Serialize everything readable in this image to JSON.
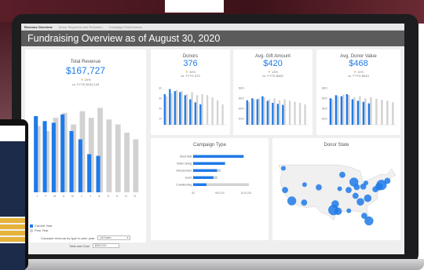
{
  "tabs": [
    "Revenue Overview",
    "Donor Segments and Retention",
    "Campaign Performance"
  ],
  "page_title": "Fundraising Overview as of August 30, 2020",
  "kpis": {
    "revenue": {
      "title": "Total Revenue",
      "value": "$167,727",
      "delta": "29%",
      "vs": "vs. FYTD $234,193"
    },
    "donors": {
      "title": "Donors",
      "value": "376",
      "delta": "34%",
      "vs": "vs. FYTD 570"
    },
    "gift": {
      "title": "Avg. Gift Amount",
      "value": "$420",
      "delta": "13%",
      "vs": "vs. FYTD $482"
    },
    "donor_value": {
      "title": "Avg. Donor Value",
      "value": "$468",
      "delta": "11%",
      "vs": "vs. FYTD $544"
    }
  },
  "legend": {
    "current": "Current Year",
    "prior": "Prior Year"
  },
  "controls": {
    "compare_label": "Compare revenue by type to prior year",
    "compare_value": "All Dates",
    "goal_label": "Total and Goal",
    "goal_value": "$500,000"
  },
  "campaign": {
    "title": "Campaign Type",
    "axis_ticks": [
      "$0",
      "$50,000",
      "$100,000"
    ]
  },
  "state": {
    "title": "Donor State"
  },
  "colors": {
    "current": "#1f7ae8",
    "prior": "#d2d2d2",
    "accent_arrow": "#e0a81c",
    "title_bar": "#5b5b5b"
  },
  "chart_data": [
    {
      "type": "bar",
      "title": "Total Revenue",
      "categories": [
        "J",
        "F",
        "M",
        "A",
        "M",
        "J",
        "J",
        "A",
        "S",
        "O",
        "N",
        "D"
      ],
      "series": [
        {
          "name": "Current Year",
          "values": [
            92,
            86,
            84,
            94,
            74,
            64,
            46,
            44,
            0,
            0,
            0,
            0
          ]
        },
        {
          "name": "Prior Year",
          "values": [
            80,
            74,
            90,
            96,
            82,
            98,
            90,
            102,
            88,
            82,
            72,
            64
          ]
        }
      ],
      "ylim": [
        0,
        110
      ]
    },
    {
      "type": "bar",
      "title": "Donors",
      "categories": [
        "1",
        "2",
        "3",
        "4",
        "5",
        "6",
        "7",
        "8",
        "9",
        "10",
        "11",
        "12"
      ],
      "series": [
        {
          "name": "Current Year",
          "values": [
            60,
            70,
            66,
            64,
            58,
            50,
            44,
            40,
            0,
            0,
            0,
            0
          ]
        },
        {
          "name": "Prior Year",
          "values": [
            56,
            62,
            68,
            66,
            60,
            64,
            58,
            60,
            58,
            54,
            48,
            40
          ]
        }
      ],
      "yticks": [
        "80",
        "60",
        "40",
        "20"
      ],
      "ylim": [
        0,
        80
      ]
    },
    {
      "type": "bar",
      "title": "Avg. Gift Amount",
      "categories": [
        "1",
        "2",
        "3",
        "4",
        "5",
        "6",
        "7",
        "8",
        "9",
        "10",
        "11",
        "12"
      ],
      "series": [
        {
          "name": "Current Year",
          "values": [
            480,
            520,
            500,
            560,
            470,
            430,
            410,
            390,
            0,
            0,
            0,
            0
          ]
        },
        {
          "name": "Prior Year",
          "values": [
            450,
            500,
            520,
            540,
            500,
            520,
            480,
            500,
            470,
            450,
            430,
            400
          ]
        }
      ],
      "yticks": [
        "$800",
        "$600",
        "$400",
        "$200"
      ],
      "ylim": [
        0,
        800
      ]
    },
    {
      "type": "bar",
      "title": "Avg. Donor Value",
      "categories": [
        "1",
        "2",
        "3",
        "4",
        "5",
        "6",
        "7",
        "8",
        "9",
        "10",
        "11",
        "12"
      ],
      "series": [
        {
          "name": "Current Year",
          "values": [
            520,
            580,
            560,
            600,
            500,
            470,
            450,
            420,
            0,
            0,
            0,
            0
          ]
        },
        {
          "name": "Prior Year",
          "values": [
            500,
            560,
            590,
            580,
            540,
            560,
            520,
            540,
            510,
            490,
            470,
            440
          ]
        }
      ],
      "yticks": [
        "$800",
        "$600",
        "$400",
        "$200"
      ],
      "ylim": [
        0,
        800
      ]
    },
    {
      "type": "bar",
      "title": "Campaign Type",
      "categories": [
        "Direct Mail",
        "Online Giving",
        "Advancement",
        "Event",
        "Crowdfunding"
      ],
      "series": [
        {
          "name": "Current Year",
          "values": [
            95000,
            60000,
            45000,
            38000,
            25000
          ]
        },
        {
          "name": "Prior Year",
          "values": [
            0,
            0,
            52000,
            46000,
            105000
          ]
        }
      ],
      "xlim": [
        0,
        130000
      ]
    },
    {
      "type": "scatter",
      "title": "Donor State",
      "points": [
        {
          "lon": -122.3,
          "lat": 47.6,
          "v": 2
        },
        {
          "lon": -118.2,
          "lat": 34.1,
          "v": 5
        },
        {
          "lon": -121.5,
          "lat": 38.6,
          "v": 3
        },
        {
          "lon": -111.9,
          "lat": 40.8,
          "v": 2
        },
        {
          "lon": -112.1,
          "lat": 33.4,
          "v": 3
        },
        {
          "lon": -104.9,
          "lat": 39.7,
          "v": 3
        },
        {
          "lon": -97.7,
          "lat": 30.3,
          "v": 6
        },
        {
          "lon": -96.8,
          "lat": 32.8,
          "v": 4
        },
        {
          "lon": -95.4,
          "lat": 29.8,
          "v": 4
        },
        {
          "lon": -93.3,
          "lat": 44.9,
          "v": 3
        },
        {
          "lon": -90.2,
          "lat": 38.6,
          "v": 3
        },
        {
          "lon": -87.6,
          "lat": 41.9,
          "v": 5
        },
        {
          "lon": -86.2,
          "lat": 39.8,
          "v": 3
        },
        {
          "lon": -84.4,
          "lat": 33.7,
          "v": 4
        },
        {
          "lon": -83.0,
          "lat": 40.0,
          "v": 3
        },
        {
          "lon": -81.7,
          "lat": 41.5,
          "v": 2
        },
        {
          "lon": -80.8,
          "lat": 35.2,
          "v": 4
        },
        {
          "lon": -80.2,
          "lat": 25.8,
          "v": 5
        },
        {
          "lon": -82.5,
          "lat": 27.9,
          "v": 3
        },
        {
          "lon": -77.0,
          "lat": 38.9,
          "v": 3
        },
        {
          "lon": -75.2,
          "lat": 40.0,
          "v": 4
        },
        {
          "lon": -74.0,
          "lat": 40.7,
          "v": 6
        },
        {
          "lon": -71.1,
          "lat": 42.4,
          "v": 3
        },
        {
          "lon": -90.1,
          "lat": 30.0,
          "v": 2
        },
        {
          "lon": -86.8,
          "lat": 36.2,
          "v": 3
        },
        {
          "lon": -94.6,
          "lat": 39.1,
          "v": 2
        }
      ]
    }
  ]
}
